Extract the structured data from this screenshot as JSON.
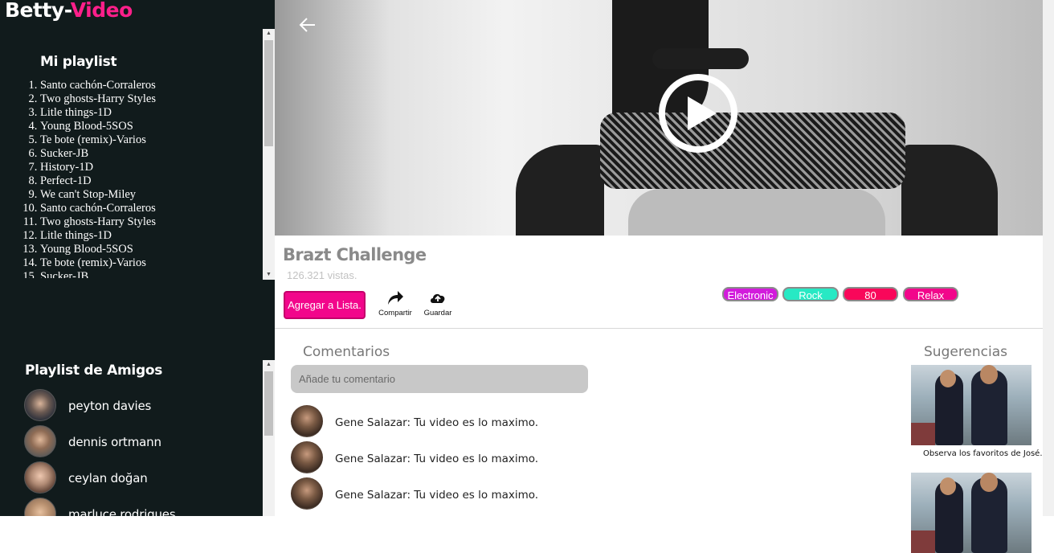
{
  "brand": {
    "part1": "Betty-",
    "part2": "Video"
  },
  "sidebar": {
    "my_playlist_title": "Mi playlist",
    "playlist": [
      "Santo cachón-Corraleros",
      "Two ghosts-Harry Styles",
      "Litle things-1D",
      "Young Blood-5SOS",
      "Te bote (remix)-Varios",
      "Sucker-JB",
      "History-1D",
      "Perfect-1D",
      "We can't Stop-Miley",
      "Santo cachón-Corraleros",
      "Two ghosts-Harry Styles",
      "Litle things-1D",
      "Young Blood-5SOS",
      "Te bote (remix)-Varios",
      "Sucker-JB"
    ],
    "friends_title": "Playlist de Amigos",
    "friends": [
      {
        "name": "peyton davies"
      },
      {
        "name": "dennis ortmann"
      },
      {
        "name": "ceylan doğan"
      },
      {
        "name": "marluce rodrigues"
      }
    ]
  },
  "video": {
    "title": "Brazt Challenge",
    "views": "126.321 vistas.",
    "add_label": "Agregar a Lista.",
    "share_label": "Compartir",
    "save_label": "Guardar",
    "tags": [
      "Electronic",
      "Rock",
      "80",
      "Relax"
    ]
  },
  "comments": {
    "title": "Comentarios",
    "placeholder": "Añade tu comentario",
    "items": [
      {
        "text": "Gene Salazar: Tu video es lo maximo."
      },
      {
        "text": "Gene Salazar: Tu video es lo maximo."
      },
      {
        "text": "Gene Salazar: Tu video es lo maximo."
      }
    ]
  },
  "suggestions": {
    "title": "Sugerencias",
    "caption": "Observa los favoritos de José."
  },
  "colors": {
    "accent": "#f2068b",
    "sidebar_bg": "#111b1c",
    "tag_electronic": "#d21bdc",
    "tag_rock": "#27e9c4",
    "tag_80": "#f9075a",
    "tag_relax": "#f2068b"
  },
  "icons": [
    "back-arrow-icon",
    "play-icon",
    "share-icon",
    "cloud-upload-icon"
  ]
}
